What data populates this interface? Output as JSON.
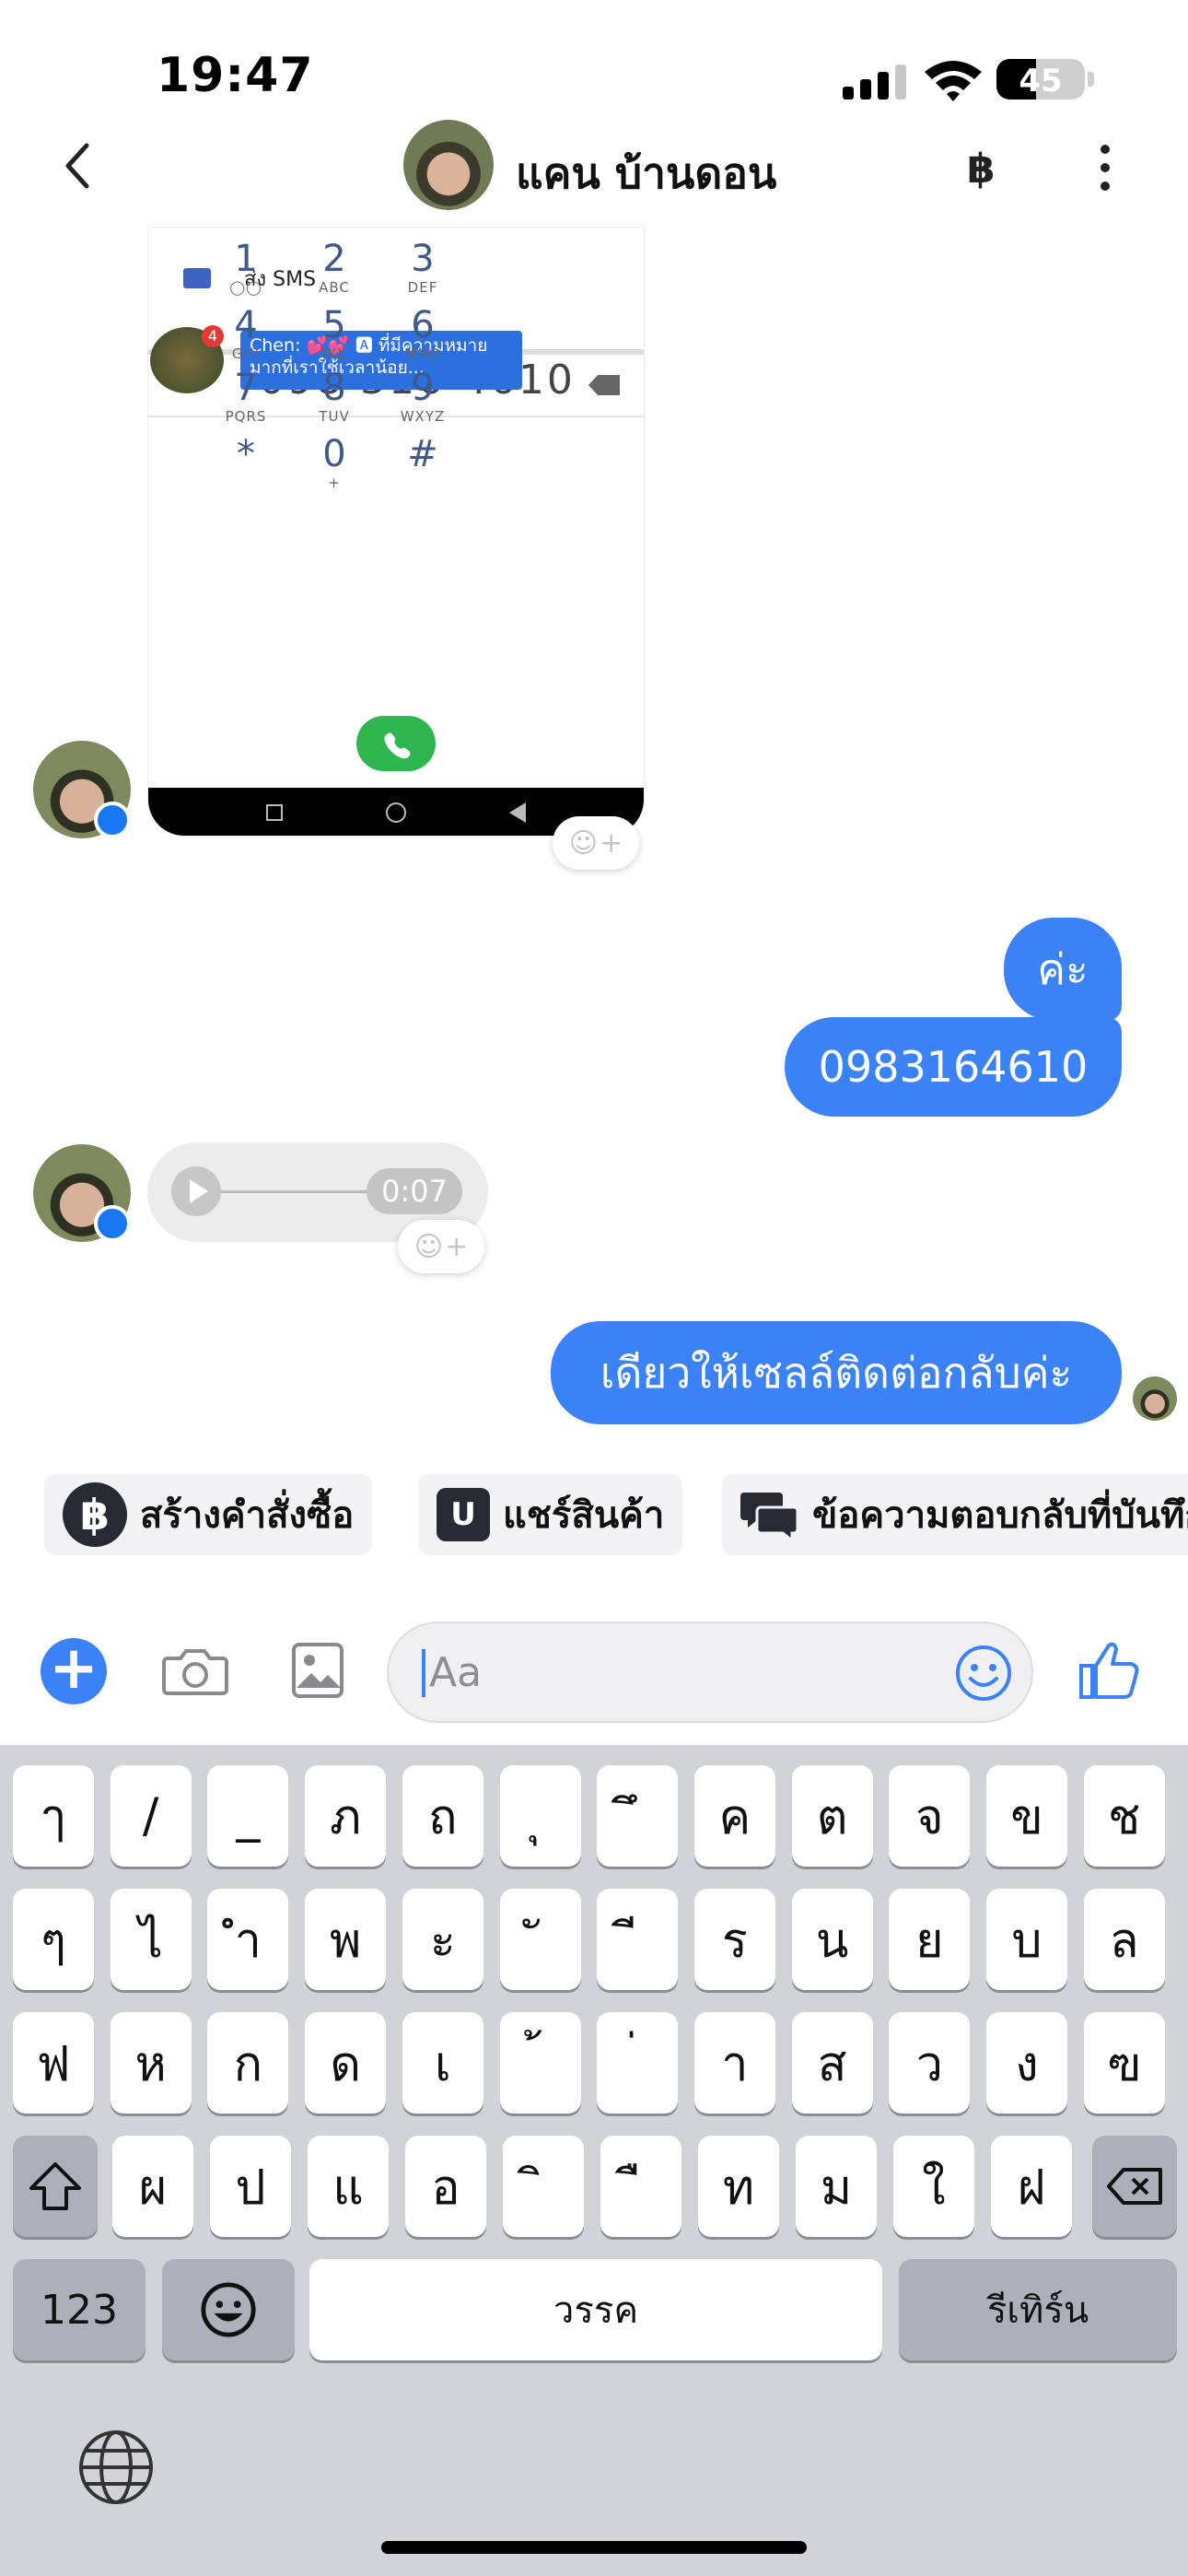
{
  "status_bar": {
    "time": "19:47",
    "battery": "45",
    "battery_level": 0.45
  },
  "header": {
    "contact_name": "แคน บ้านดอน",
    "currency_icon_label": "฿",
    "back_icon": "chevron-left-icon",
    "more_icon": "kebab-icon"
  },
  "screenshot": {
    "sms_label": "ส่ง SMS",
    "notification_text": "Chen: 💕💕 🅰 ที่มีความหมายมากที่เราใช้เวลาน้อย...",
    "notification_badge": "4",
    "dialed_number": "098 316 4610",
    "keys": [
      {
        "d": "1",
        "l": "◯◯"
      },
      {
        "d": "2",
        "l": "ABC"
      },
      {
        "d": "3",
        "l": "DEF"
      },
      {
        "d": "4",
        "l": "GHI"
      },
      {
        "d": "5",
        "l": "JKL"
      },
      {
        "d": "6",
        "l": "MNO"
      },
      {
        "d": "7",
        "l": "PQRS"
      },
      {
        "d": "8",
        "l": "TUV"
      },
      {
        "d": "9",
        "l": "WXYZ"
      },
      {
        "d": "*",
        "l": ""
      },
      {
        "d": "0",
        "l": "+"
      },
      {
        "d": "#",
        "l": ""
      }
    ]
  },
  "messages": {
    "out1": "ค่ะ",
    "out2": "0983164610",
    "voice_duration": "0:07",
    "out3": "เดียวให้เซลล์ติดต่อกลับค่ะ"
  },
  "reaction_button": {
    "icon": "smile-plus-icon",
    "plus": "+"
  },
  "quick_actions": [
    {
      "icon": "฿",
      "label": "สร้างคำสั่งซื้อ"
    },
    {
      "icon": "U",
      "label": "แชร์สินค้า"
    },
    {
      "icon": "💬",
      "label": "ข้อความตอบกลับที่บันทึกไว้"
    }
  ],
  "composer": {
    "placeholder": "Aa",
    "plus_label": "+"
  },
  "keyboard": {
    "row1": [
      "ๅ",
      "/",
      "_",
      "ภ",
      "ถ",
      "ุ",
      "ึ",
      "ค",
      "ต",
      "จ",
      "ข",
      "ช"
    ],
    "row2": [
      "ๆ",
      "ไ",
      "ำ",
      "พ",
      "ะ",
      "ั",
      "ี",
      "ร",
      "น",
      "ย",
      "บ",
      "ล"
    ],
    "row3": [
      "ฟ",
      "ห",
      "ก",
      "ด",
      "เ",
      "้",
      "่",
      "า",
      "ส",
      "ว",
      "ง",
      "ฃ"
    ],
    "row4": [
      "ผ",
      "ป",
      "แ",
      "อ",
      "ิ",
      "ื",
      "ท",
      "ม",
      "ใ",
      "ฝ"
    ],
    "numbers_key": "123",
    "space_key": "วรรค",
    "return_key": "รีเทิร์น"
  },
  "colors": {
    "accent": "#3b82f6",
    "bubble_out": "#3b82f6",
    "keyboard_bg": "#d1d3d9"
  }
}
